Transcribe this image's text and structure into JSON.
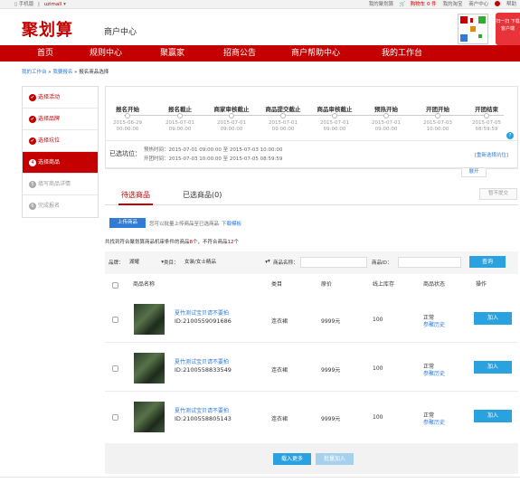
{
  "topbar": {
    "mobile": "手机版",
    "username": "uzimall",
    "my_jhs": "我的聚划算",
    "cart": "购物车 0 件",
    "my_taobao": "我的淘宝",
    "merchant": "商户中心",
    "help": "帮助"
  },
  "header": {
    "logo": "聚划算",
    "subtitle": "商户中心",
    "promo": "扫一扫 下载客户端"
  },
  "nav": [
    "首页",
    "规则中心",
    "聚赢家",
    "招商公告",
    "商户帮助中心",
    "我的工作台"
  ],
  "breadcrumb": {
    "home": "我的工作台",
    "sep1": " » ",
    "parent": "我要报名",
    "sep2": " » ",
    "current": "报名商品选择"
  },
  "sidebar": [
    {
      "label": "选择活动",
      "icon": "check",
      "state": "done"
    },
    {
      "label": "选择品牌",
      "icon": "check",
      "state": "done"
    },
    {
      "label": "选择坑位",
      "icon": "check",
      "state": "done"
    },
    {
      "label": "选择商品",
      "icon": "4",
      "state": "active"
    },
    {
      "label": "填写商品详情",
      "icon": "5",
      "state": "todo"
    },
    {
      "label": "完成报名",
      "icon": "6",
      "state": "todo"
    }
  ],
  "timeline": [
    {
      "name": "报名开始",
      "date": "2015-06-29",
      "time": "00:00:00"
    },
    {
      "name": "报名截止",
      "date": "2015-07-01",
      "time": "09:00:00"
    },
    {
      "name": "商家审核截止",
      "date": "2015-07-01",
      "time": "09:00:00"
    },
    {
      "name": "商品提交截止",
      "date": "2015-07-01",
      "time": "09:00:00"
    },
    {
      "name": "商品审核截止",
      "date": "2015-07-01",
      "time": "09:00:00"
    },
    {
      "name": "预热开始",
      "date": "2015-07-01",
      "time": "09:00:00"
    },
    {
      "name": "开团开始",
      "date": "2015-07-03",
      "time": "10:00:00"
    },
    {
      "name": "开团结束",
      "date": "2015-07-05",
      "time": "08:59:59"
    }
  ],
  "help_icon": "?",
  "slot": {
    "label": "已选坑位：",
    "preheat": "预热时间：2015-07-01 09:00:00 至 2015-07-03 10:00:00",
    "open": "开团时间：2015-07-03 10:00:00 至 2015-07-05 08:59:59",
    "reselect": "[重新选择坑位]"
  },
  "expand_label": "展开",
  "tabs": {
    "pending": "待选商品",
    "selected": "已选商品(0)",
    "submit": "暂不提交"
  },
  "upload": {
    "button": "上传商品",
    "tip": "您可以批量上传商品至已选商品",
    "template": "下载模板"
  },
  "count": {
    "prefix": "共找到符合聚划算商品机审条件的商品",
    "match": "8",
    "mid": "个，不符合商品",
    "nonmatch": "12",
    "suffix": "个"
  },
  "filter": {
    "brand_label": "品牌：",
    "brand_value": "湖耀",
    "category_label": "类目：",
    "category_value": "女装/女士精品",
    "name_label": "商品名称：",
    "id_label": "商品ID：",
    "query": "查询"
  },
  "table": {
    "headers": [
      "商品名称",
      "类目",
      "原价",
      "线上库存",
      "商品状态",
      "操作"
    ],
    "rows": [
      {
        "name": "夏竹测试宝贝请不要拍",
        "id": "ID:2100559091686",
        "category": "连衣裙",
        "price": "9999元",
        "stock": "100",
        "status": "正常",
        "history": "参聚历史",
        "action": "加入"
      },
      {
        "name": "夏竹测试宝贝请不要拍",
        "id": "ID:2100558833549",
        "category": "连衣裙",
        "price": "9999元",
        "stock": "100",
        "status": "正常",
        "history": "参聚历史",
        "action": "加入"
      },
      {
        "name": "夏竹测试宝贝请不要拍",
        "id": "ID:2100558805143",
        "category": "连衣裙",
        "price": "9999元",
        "stock": "100",
        "status": "正常",
        "history": "参聚历史",
        "action": "加入"
      }
    ]
  },
  "footer": {
    "load_more": "载入更多",
    "batch_add": "批量加入"
  },
  "colors": {
    "brand_red": "#c40000",
    "link_blue": "#2f7bd6",
    "button_blue": "#2aa2e0"
  }
}
